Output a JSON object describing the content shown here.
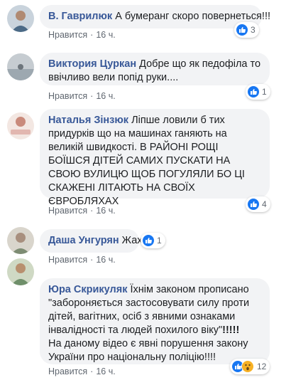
{
  "comments": [
    {
      "author": "В. Гаврилюк",
      "text": "А бумеранг скоро повернеться!!!",
      "like_label": "Нравится",
      "time": "16 ч.",
      "reactions": [
        "like"
      ],
      "count": "3",
      "avatar_color": "#4b6a86"
    },
    {
      "author": "Виктория Цуркан",
      "text": "Добре що як педофіла то ввічливо вели попід руки....",
      "like_label": "Нравится",
      "time": "16 ч.",
      "reactions": [
        "like"
      ],
      "count": "1",
      "avatar_color": "#9da8b0"
    },
    {
      "author": "Наталья Зінзюк",
      "text": "Лiпше ловили б тих придурків що на машинах ганяють на великій швидкості. В РАЙОНІ РОЩІ БОЇШСЯ ДІТЕЙ САМИХ ПУСКАТИ НА СВОЮ ВУЛИЦЮ ЩОБ ПОГУЛЯЛИ БО ЦІ СКАЖЕНІ ЛІТАЮТЬ НА СВОЇХ ЄВРОБЛЯХАХ",
      "like_label": "Нравится",
      "time": "16 ч.",
      "reactions": [
        "like"
      ],
      "count": "4",
      "avatar_color": "#e2b7b0"
    },
    {
      "author": "Даша Унгурян",
      "text": "Жах.",
      "like_label": "Нравится",
      "time": "16 ч.",
      "reactions": [
        "like"
      ],
      "count": "1",
      "avatar_color": "#b9b3a6"
    },
    {
      "author": "Юра Скрикуляк",
      "text_main": "Їхнім законом прописано \"забороняється застосовувати силу проти дітей, вагітних, осіб з явними ознаками інвалідності та людей похилого віку\"",
      "text_excl": "!!!!!",
      "text_second": "На даному відео є явні порушення закону України про національну поліцію!!!!",
      "like_label": "Нравится",
      "time": "16 ч.",
      "reactions": [
        "like",
        "wow"
      ],
      "count": "12",
      "avatar_color": "#6f8f6a"
    }
  ],
  "colors": {
    "author": "#385898",
    "like_blue": "#1877f2",
    "wow_yellow": "#f7b125",
    "bubble_bg": "#f2f3f5"
  }
}
